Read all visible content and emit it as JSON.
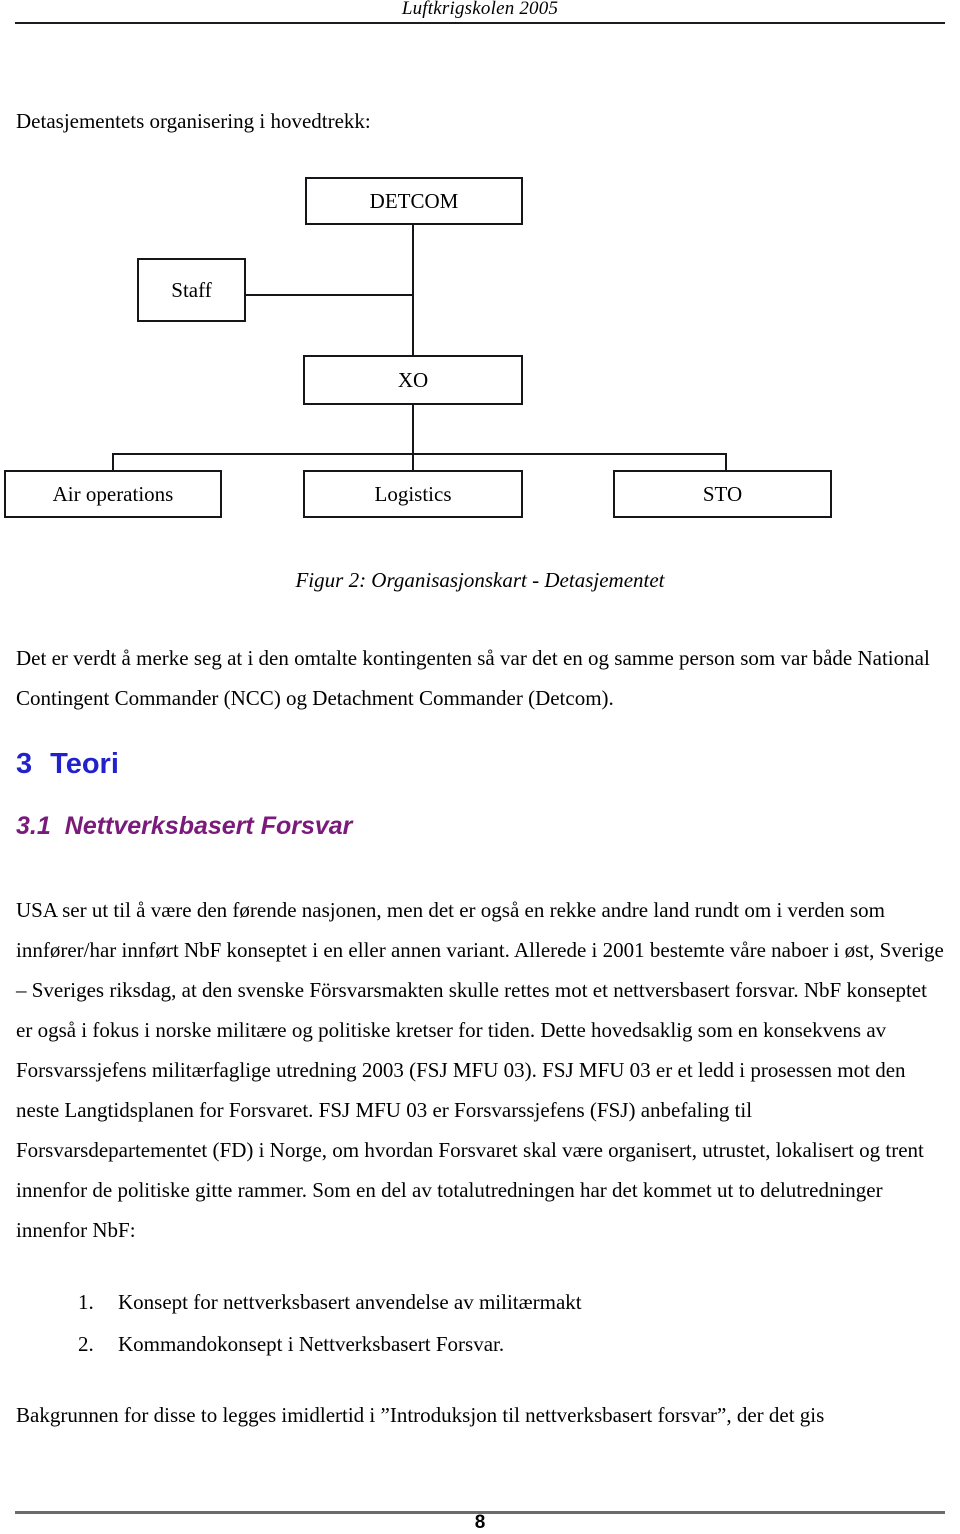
{
  "header": {
    "running_title": "Luftkrigskolen 2005"
  },
  "intro_line": "Detasjementets organisering i hovedtrekk:",
  "org_chart": {
    "boxes": {
      "detcom": "DETCOM",
      "staff": "Staff",
      "xo": "XO",
      "air_operations": "Air operations",
      "logistics": "Logistics",
      "sto": "STO"
    }
  },
  "figure_caption": "Figur 2: Organisasjonskart - Detasjementet",
  "paragraphs": {
    "intro": "Det er verdt å merke seg at i den omtalte kontingenten så var det en og samme person som var både National Contingent Commander (NCC) og Detachment Commander (Detcom).",
    "usa": "USA ser ut til å være den førende nasjonen, men det er også en rekke andre land rundt om i verden som innfører/har innført NbF konseptet i en eller annen variant. Allerede i 2001 bestemte våre naboer i øst, Sverige – Sveriges riksdag, at den svenske Försvarsmakten skulle rettes mot et nettversbasert forsvar. NbF konseptet er også i fokus i norske militære og politiske kretser for tiden. Dette hovedsaklig som en konsekvens av Forsvarssjefens militærfaglige utredning 2003 (FSJ MFU 03). FSJ MFU 03 er et ledd i prosessen mot den neste Langtidsplanen for Forsvaret. FSJ MFU 03 er Forsvarssjefens (FSJ) anbefaling til Forsvarsdepartementet (FD) i Norge, om hvordan Forsvaret skal være organisert, utrustet, lokalisert og trent innenfor de politiske gitte rammer. Som en del av totalutredningen har det kommet ut to delutredninger innenfor NbF:",
    "closing": "Bakgrunnen for disse to legges imidlertid i ”Introduksjon til nettverksbasert forsvar”, der det gis"
  },
  "headings": {
    "section_3": {
      "number": "3",
      "title": "Teori",
      "color": "#2222cc"
    },
    "section_3_1": {
      "number": "3.1",
      "title": "Nettverksbasert Forsvar",
      "color": "#7a1a7a"
    }
  },
  "numbered_list": [
    {
      "marker": "1.",
      "text": "Konsept for nettverksbasert anvendelse av militærmakt"
    },
    {
      "marker": "2.",
      "text": "Kommandokonsept i Nettverksbasert Forsvar."
    }
  ],
  "footer": {
    "page_number": "8"
  }
}
